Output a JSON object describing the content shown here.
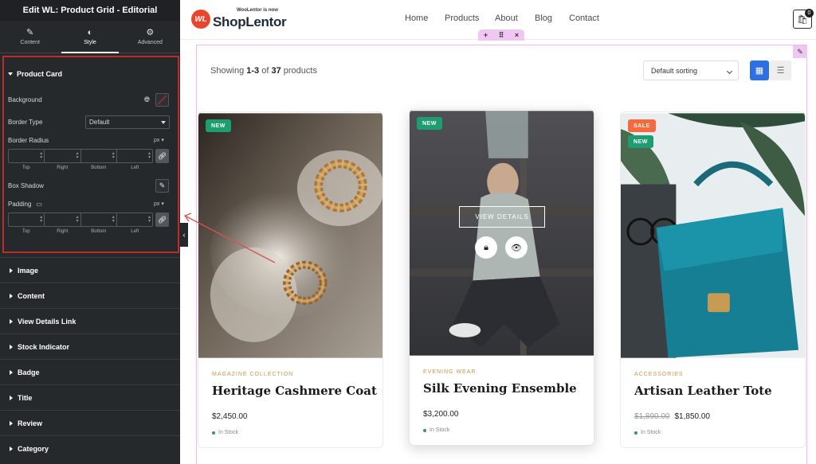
{
  "sidebar": {
    "header_title": "Edit WL: Product Grid - Editorial",
    "tabs": [
      {
        "label": "Content",
        "icon": "pencil-icon"
      },
      {
        "label": "Style",
        "icon": "half-circle-icon"
      },
      {
        "label": "Advanced",
        "icon": "gear-icon"
      }
    ],
    "active_tab": "Style",
    "section_title": "Product Card",
    "controls": {
      "background_label": "Background",
      "border_type_label": "Border Type",
      "border_type_value": "Default",
      "border_radius_label": "Border Radius",
      "unit": "px",
      "dim_labels": [
        "Top",
        "Right",
        "Bottom",
        "Left"
      ],
      "box_shadow_label": "Box Shadow",
      "padding_label": "Padding"
    },
    "collapsed_sections": [
      "Image",
      "Content",
      "View Details Link",
      "Stock Indicator",
      "Badge",
      "Title",
      "Review",
      "Category"
    ]
  },
  "site": {
    "logo_tagline": "WooLentor is now",
    "logo_name": "ShopLentor",
    "logo_mark": "WL",
    "nav": [
      "Home",
      "Products",
      "About",
      "Blog",
      "Contact"
    ],
    "cart_count": "0"
  },
  "toolbar": {
    "showing_prefix": "Showing ",
    "showing_range": "1-3",
    "showing_mid": " of ",
    "showing_total": "37",
    "showing_suffix": " products",
    "sort_value": "Default sorting"
  },
  "products": [
    {
      "badges": [
        "NEW"
      ],
      "category": "MAGAZINE COLLECTION",
      "title": "Heritage Cashmere Coat",
      "price": "$2,450.00",
      "old_price": "",
      "stock": "In Stock"
    },
    {
      "badges": [
        "NEW"
      ],
      "category": "EVENING WEAR",
      "title": "Silk Evening Ensemble",
      "price": "$3,200.00",
      "old_price": "",
      "stock": "In Stock",
      "overlay_button": "VIEW DETAILS"
    },
    {
      "badges": [
        "SALE",
        "NEW"
      ],
      "category": "ACCESSORIES",
      "title": "Artisan Leather Tote",
      "price": "$1,850.00",
      "old_price": "$1,890.00",
      "stock": "In Stock"
    }
  ],
  "colors": {
    "sidebar_bg": "#26292c",
    "highlight_red": "#c22a2a",
    "new_badge": "#1e9d71",
    "sale_badge": "#f26a3d",
    "accent_blue": "#2f6fe4",
    "category_gold": "#d19440",
    "edit_pink": "#f0c6f3"
  }
}
